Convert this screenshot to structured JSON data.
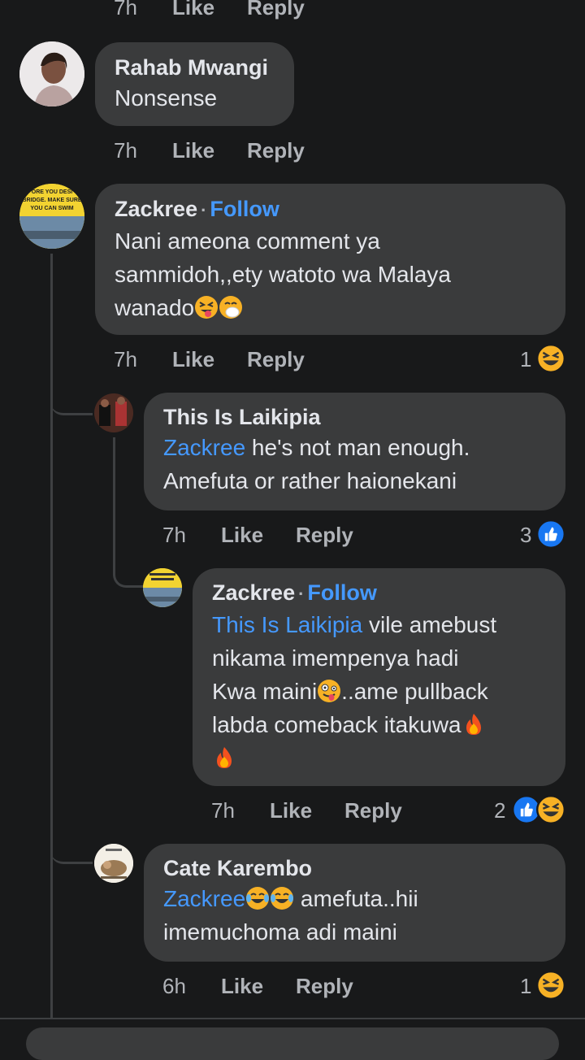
{
  "top_meta": {
    "time": "7h",
    "like": "Like",
    "reply": "Reply"
  },
  "comments": [
    {
      "name": "Rahab Mwangi",
      "text": "Nonsense",
      "time": "7h",
      "like": "Like",
      "reply": "Reply"
    },
    {
      "name": "Zackree",
      "follow": "Follow",
      "line1": "Nani ameona comment ya",
      "line2": "sammidoh,,ety watoto wa Malaya",
      "line3": "wanado",
      "time": "7h",
      "like": "Like",
      "reply": "Reply",
      "reaction_count": "1"
    },
    {
      "name": "This Is Laikipia",
      "mention": "Zackree",
      "line1": " he's not man enough.",
      "line2": "Amefuta or rather haionekani",
      "time": "7h",
      "like": "Like",
      "reply": "Reply",
      "reaction_count": "3"
    },
    {
      "name": "Zackree",
      "follow": "Follow",
      "mention": "This Is Laikipia",
      "line1": " vile amebust",
      "line2": "nikama imempenya hadi",
      "line3a": "Kwa maini",
      "line3b": "..ame pullback",
      "line4": "labda comeback itakuwa",
      "time": "7h",
      "like": "Like",
      "reply": "Reply",
      "reaction_count": "2"
    },
    {
      "name": "Cate Karembo",
      "mention": "Zackree",
      "line1": " amefuta..hii",
      "line2": "imemuchoma adi maini",
      "time": "6h",
      "like": "Like",
      "reply": "Reply",
      "reaction_count": "1"
    }
  ],
  "avatar_text": {
    "zackree_sign_1": "ORE YOU DESI",
    "zackree_sign_2": "BRIDGE. MAKE SURE",
    "zackree_sign_3": "YOU CAN SWIM"
  },
  "colors": {
    "background": "#18191a",
    "bubble": "#3a3b3c",
    "link": "#4599ff",
    "muted": "#b0b3b8",
    "like_blue": "#1877f2",
    "emoji_yellow": "#f7b125"
  }
}
